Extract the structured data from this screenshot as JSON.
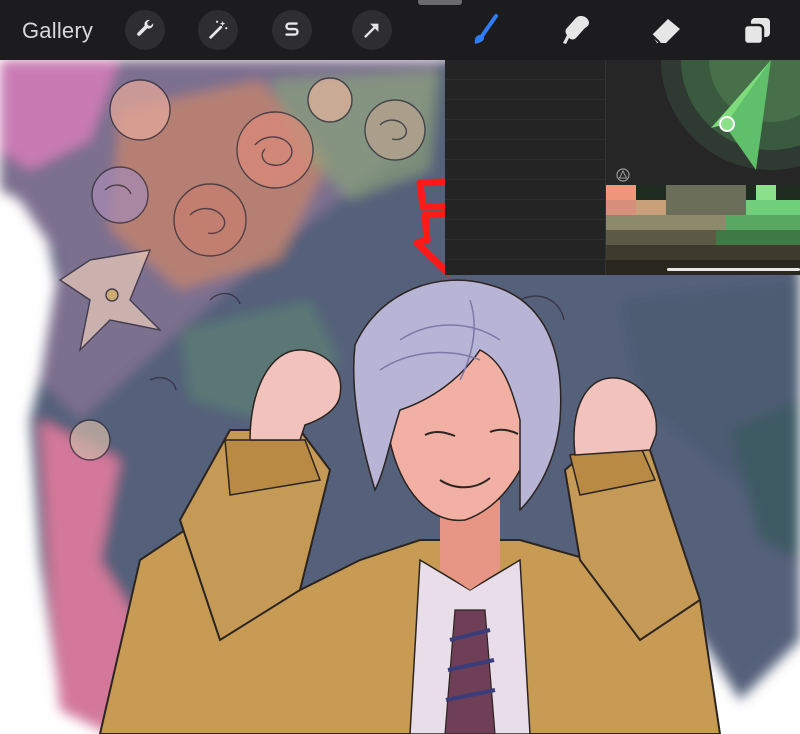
{
  "toolbar": {
    "gallery_label": "Gallery",
    "left_tools": [
      "wrench-icon",
      "magic-wand-icon",
      "selection-s-icon",
      "transform-arrow-icon"
    ],
    "right_tools": [
      "brush-icon",
      "smudge-icon",
      "eraser-icon",
      "layers-icon"
    ],
    "active_tool": "brush-icon",
    "active_color": "#2f7cf6"
  },
  "color_panel": {
    "wheel_color": "#5fbf6a",
    "selected_color": "#8be08a"
  },
  "annotation": {
    "color": "#ff1a1a",
    "shape": "down-arrow"
  }
}
